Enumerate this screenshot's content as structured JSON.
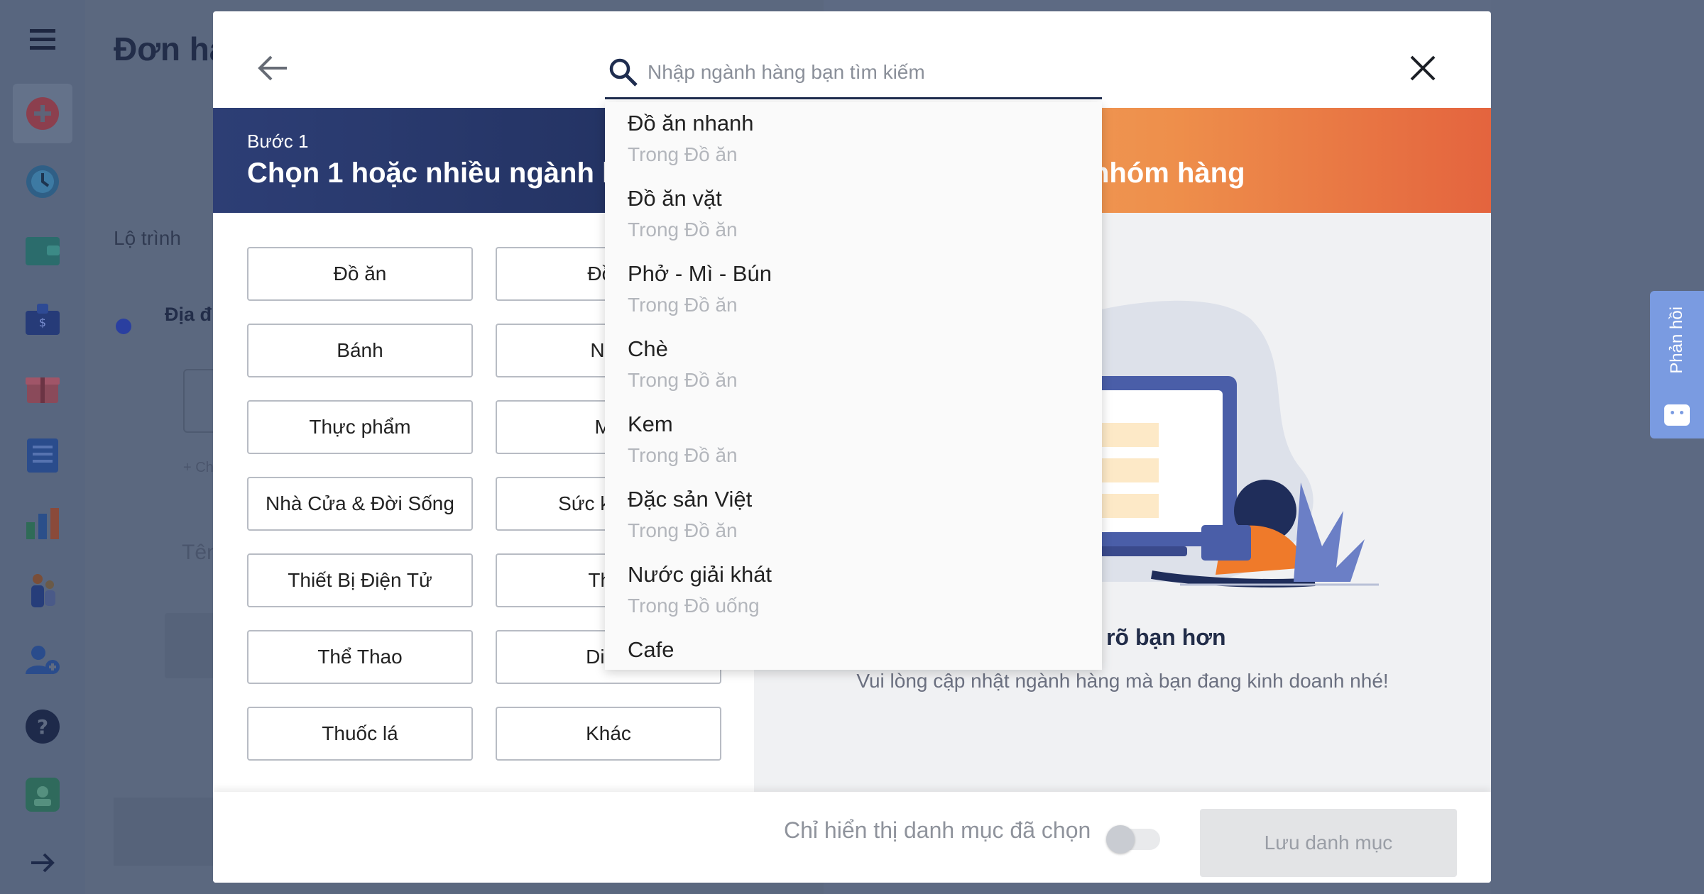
{
  "background": {
    "page_title": "Đơn hà",
    "subtitle": "Lộ trình",
    "address_label": "Địa đ",
    "small_link": "+ Ch",
    "name_placeholder": "Tên"
  },
  "feedback": {
    "label": "Phản hồi"
  },
  "modal": {
    "search": {
      "placeholder": "Nhập ngành hàng bạn tìm kiếm",
      "value": ""
    },
    "step": {
      "label": "Bước 1",
      "title": "Chọn 1 hoặc nhiều ngành hà",
      "step2_title": "nhóm hàng"
    },
    "categories": {
      "left": [
        "Đồ ăn",
        "Bánh",
        "Thực phẩm",
        "Nhà Cửa & Đời Sống",
        "Thiết Bị Điện Tử",
        "Thể Thao",
        "Thuốc lá"
      ],
      "right": [
        "Đồ u",
        "Nhà",
        "Mẹ",
        "Sức khoẻ v",
        "Thời",
        "Di ch",
        "Khác"
      ]
    },
    "right_panel": {
      "title": "tôi hiểu rõ bạn hơn",
      "description": "Vui lòng cập nhật ngành hàng mà bạn đang kinh doanh nhé!"
    },
    "footer": {
      "toggle_label": "Chỉ hiển thị danh mục đã chọn",
      "toggle_on": false,
      "save_label": "Lưu danh mục"
    }
  },
  "dropdown": {
    "items": [
      {
        "name": "Đồ ăn nhanh",
        "sub": "Trong Đồ ăn"
      },
      {
        "name": "Đồ ăn vặt",
        "sub": "Trong Đồ ăn"
      },
      {
        "name": "Phở - Mì - Bún",
        "sub": "Trong Đồ ăn"
      },
      {
        "name": "Chè",
        "sub": "Trong Đồ ăn"
      },
      {
        "name": "Kem",
        "sub": "Trong Đồ ăn"
      },
      {
        "name": "Đặc sản Việt",
        "sub": "Trong Đồ ăn"
      },
      {
        "name": "Nước giải khát",
        "sub": "Trong Đồ uống"
      },
      {
        "name": "Cafe",
        "sub": ""
      }
    ]
  },
  "colors": {
    "header_dark": "#1e2b55",
    "header_orange": "#ee8f4b",
    "feedback_blue": "#7a9be1",
    "sidebar_bg": "#58667f"
  },
  "icons": {
    "sidebar": [
      "menu-icon",
      "add-circle-icon",
      "clock-icon",
      "wallet-icon",
      "briefcase-money-icon",
      "gift-icon",
      "list-document-icon",
      "bar-chart-icon",
      "people-icon",
      "add-user-icon",
      "help-icon",
      "badge-icon",
      "arrow-right-icon"
    ],
    "modal": [
      "back-arrow-icon",
      "search-icon",
      "close-icon"
    ]
  }
}
